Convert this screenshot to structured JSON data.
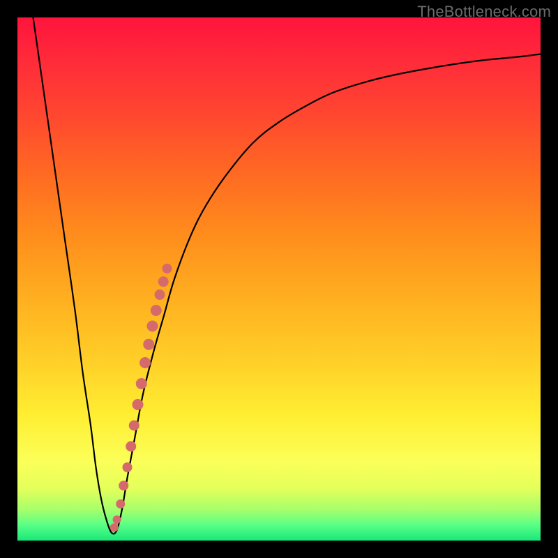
{
  "watermark": "TheBottleneck.com",
  "colors": {
    "frame": "#000000",
    "curve": "#000000",
    "marker": "#d46a6a",
    "marker_stroke_opacity": 0.0
  },
  "chart_data": {
    "type": "line",
    "title": "",
    "xlabel": "",
    "ylabel": "",
    "xlim": [
      0,
      100
    ],
    "ylim": [
      0,
      100
    ],
    "grid": false,
    "legend": false,
    "background": "vertical-gradient red→yellow→green (bottleneck heatmap)",
    "series": [
      {
        "name": "bottleneck-curve",
        "x": [
          3,
          5,
          7,
          9,
          11,
          12.5,
          14,
          15,
          16,
          17,
          18,
          19,
          20,
          21,
          22.5,
          24,
          26,
          28,
          30,
          33,
          36,
          40,
          45,
          50,
          55,
          60,
          66,
          72,
          80,
          88,
          96,
          100
        ],
        "y": [
          100,
          86,
          72,
          58,
          44,
          32,
          22,
          14,
          8,
          4,
          1.5,
          2,
          6,
          12,
          20,
          28,
          36,
          43,
          50,
          58,
          64,
          70,
          76,
          80,
          83,
          85.5,
          87.5,
          89,
          90.5,
          91.7,
          92.5,
          93
        ]
      }
    ],
    "annotations": [
      {
        "name": "highlight-segment",
        "type": "marker-run",
        "description": "thick salmon/rose overlay on ascending branch",
        "x": [
          18.5,
          19.0,
          19.7,
          20.3,
          21.0,
          21.7,
          22.3,
          23.0,
          23.7,
          24.4,
          25.1,
          25.8,
          26.5,
          27.2,
          27.9,
          28.6
        ],
        "y": [
          2.5,
          4.0,
          7.0,
          10.5,
          14.0,
          18.0,
          22.0,
          26.0,
          30.0,
          34.0,
          37.5,
          41.0,
          44.0,
          47.0,
          49.5,
          52.0
        ],
        "radius_px": [
          6,
          6,
          6.5,
          7,
          7,
          7.5,
          7.5,
          8,
          8,
          8,
          8,
          8,
          8,
          7.5,
          7.5,
          7
        ]
      }
    ]
  }
}
